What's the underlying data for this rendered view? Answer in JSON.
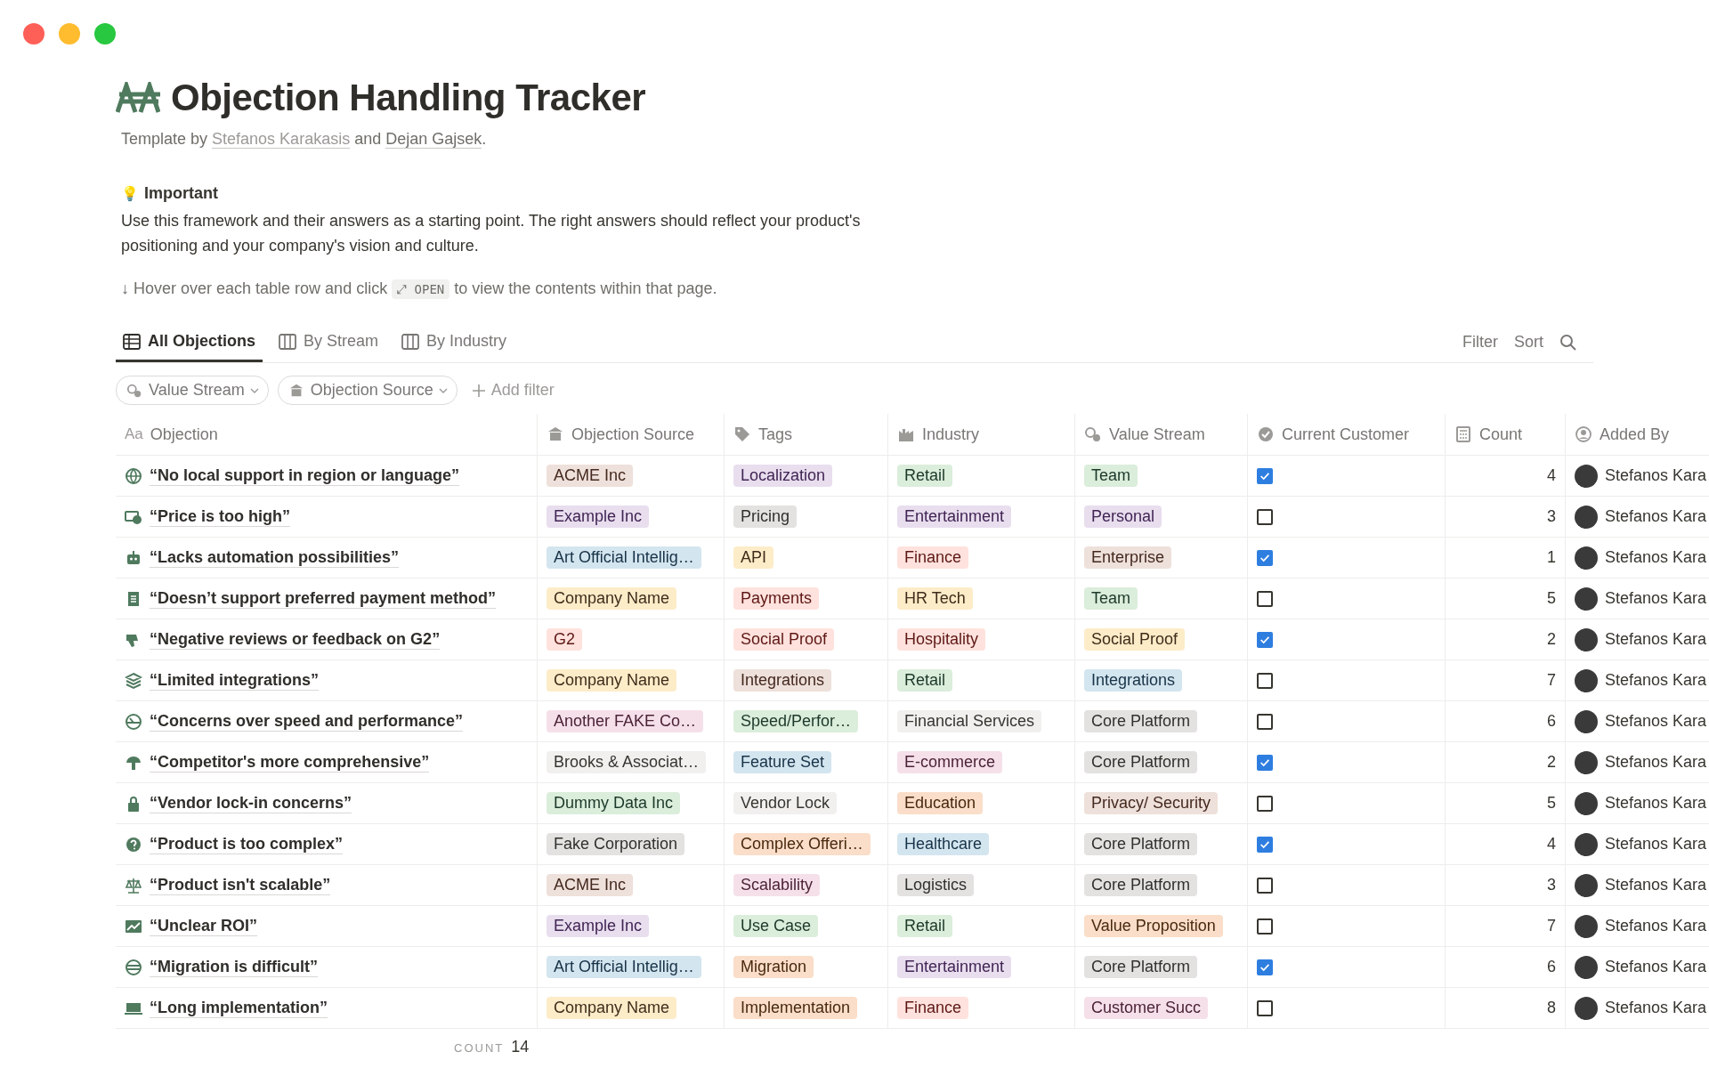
{
  "page": {
    "title": "Objection Handling Tracker",
    "byline": [
      {
        "kind": "text",
        "text": "Template by "
      },
      {
        "kind": "link",
        "text": "Stefanos Karakasis"
      },
      {
        "kind": "text",
        "text": " and "
      },
      {
        "kind": "link",
        "text": "Dejan Gajsek"
      },
      {
        "kind": "text",
        "text": "."
      }
    ],
    "callout": {
      "icon": "💡",
      "heading": "Important",
      "body": "Use this framework and their answers as a starting point. The right answers should reflect your product's positioning and your company's vision and culture."
    },
    "hint": {
      "before": "↓ Hover over each table row and click",
      "chip": "⤢ OPEN",
      "after": "to view the contents within that page."
    }
  },
  "tabs": [
    {
      "label": "All Objections",
      "selected": true,
      "kind": "table"
    },
    {
      "label": "By Stream",
      "selected": false,
      "kind": "board"
    },
    {
      "label": "By Industry",
      "selected": false,
      "kind": "board"
    }
  ],
  "toolbar": [
    "Filter",
    "Sort"
  ],
  "filters": [
    {
      "label": "Value Stream",
      "kind": "chip"
    },
    {
      "label": "Objection Source",
      "kind": "chip"
    },
    {
      "label": "Add filter",
      "kind": "add"
    }
  ],
  "table": {
    "columns": [
      {
        "label": "Objection",
        "prefix": "Aa",
        "kind": "title"
      },
      {
        "label": "Objection Source",
        "kind": "source"
      },
      {
        "label": "Tags",
        "kind": "tags"
      },
      {
        "label": "Industry",
        "kind": "industry"
      },
      {
        "label": "Value Stream",
        "kind": "stream"
      },
      {
        "label": "Current Customer",
        "kind": "customer"
      },
      {
        "label": "Count",
        "kind": "count"
      },
      {
        "label": "Added By",
        "kind": "person"
      }
    ],
    "rows": [
      {
        "objection": "“No local support in region or language”",
        "source": {
          "text": "ACME Inc",
          "color": "#eee0da"
        },
        "tag": {
          "text": "Localization",
          "color": "#e8deee"
        },
        "industry": {
          "text": "Retail",
          "color": "#dbeddb"
        },
        "stream": {
          "text": "Team",
          "color": "#dbeddb"
        },
        "current_customer": true,
        "count": "4",
        "added_by": "Stefanos Kara"
      },
      {
        "objection": "“Price is too high”",
        "source": {
          "text": "Example Inc",
          "color": "#e8deee"
        },
        "tag": {
          "text": "Pricing",
          "color": "#e3e2e0"
        },
        "industry": {
          "text": "Entertainment",
          "color": "#e8deee"
        },
        "stream": {
          "text": "Personal",
          "color": "#e8deee"
        },
        "current_customer": false,
        "count": "3",
        "added_by": "Stefanos Kara"
      },
      {
        "objection": "“Lacks automation possibilities”",
        "source": {
          "text": "Art Official Intellig…",
          "color": "#d3e5ef"
        },
        "tag": {
          "text": "API",
          "color": "#fdecc8"
        },
        "industry": {
          "text": "Finance",
          "color": "#ffe2dd"
        },
        "stream": {
          "text": "Enterprise",
          "color": "#eee0da"
        },
        "current_customer": true,
        "count": "1",
        "added_by": "Stefanos Kara"
      },
      {
        "objection": "“Doesn’t support preferred payment method”",
        "source": {
          "text": "Company Name",
          "color": "#fdecc8"
        },
        "tag": {
          "text": "Payments",
          "color": "#ffe2dd"
        },
        "industry": {
          "text": "HR Tech",
          "color": "#fdecc8"
        },
        "stream": {
          "text": "Team",
          "color": "#dbeddb"
        },
        "current_customer": false,
        "count": "5",
        "added_by": "Stefanos Kara"
      },
      {
        "objection": "“Negative reviews or feedback on G2”",
        "source": {
          "text": "G2",
          "color": "#ffe2dd"
        },
        "tag": {
          "text": "Social Proof",
          "color": "#ffe2dd"
        },
        "industry": {
          "text": "Hospitality",
          "color": "#ffe2dd"
        },
        "stream": {
          "text": "Social Proof",
          "color": "#fdecc8"
        },
        "current_customer": true,
        "count": "2",
        "added_by": "Stefanos Kara"
      },
      {
        "objection": "“Limited integrations”",
        "source": {
          "text": "Company Name",
          "color": "#fdecc8"
        },
        "tag": {
          "text": "Integrations",
          "color": "#eee0da"
        },
        "industry": {
          "text": "Retail",
          "color": "#dbeddb"
        },
        "stream": {
          "text": "Integrations",
          "color": "#d3e5ef"
        },
        "current_customer": false,
        "count": "7",
        "added_by": "Stefanos Kara"
      },
      {
        "objection": "“Concerns over speed and performance”",
        "source": {
          "text": "Another FAKE Co…",
          "color": "#f5e0e9"
        },
        "tag": {
          "text": "Speed/Perfor…",
          "color": "#dbeddb"
        },
        "industry": {
          "text": "Financial Services",
          "color": "#f1f0ef"
        },
        "stream": {
          "text": "Core Platform",
          "color": "#e3e2e0"
        },
        "current_customer": false,
        "count": "6",
        "added_by": "Stefanos Kara"
      },
      {
        "objection": "“Competitor's more comprehensive”",
        "source": {
          "text": "Brooks & Associat…",
          "color": "#f1f0ef"
        },
        "tag": {
          "text": "Feature Set",
          "color": "#d3e5ef"
        },
        "industry": {
          "text": "E-commerce",
          "color": "#f5e0e9"
        },
        "stream": {
          "text": "Core Platform",
          "color": "#e3e2e0"
        },
        "current_customer": true,
        "count": "2",
        "added_by": "Stefanos Kara"
      },
      {
        "objection": "“Vendor lock-in concerns”",
        "source": {
          "text": "Dummy Data Inc",
          "color": "#dbeddb"
        },
        "tag": {
          "text": "Vendor Lock",
          "color": "#f1f0ef"
        },
        "industry": {
          "text": "Education",
          "color": "#fadec9"
        },
        "stream": {
          "text": "Privacy/ Security",
          "color": "#eee0da"
        },
        "current_customer": false,
        "count": "5",
        "added_by": "Stefanos Kara"
      },
      {
        "objection": "“Product is too complex”",
        "source": {
          "text": "Fake Corporation",
          "color": "#e3e2e0"
        },
        "tag": {
          "text": "Complex Offeri…",
          "color": "#fadec9"
        },
        "industry": {
          "text": "Healthcare",
          "color": "#d3e5ef"
        },
        "stream": {
          "text": "Core Platform",
          "color": "#e3e2e0"
        },
        "current_customer": true,
        "count": "4",
        "added_by": "Stefanos Kara"
      },
      {
        "objection": "“Product isn't scalable”",
        "source": {
          "text": "ACME Inc",
          "color": "#eee0da"
        },
        "tag": {
          "text": "Scalability",
          "color": "#f5e0e9"
        },
        "industry": {
          "text": "Logistics",
          "color": "#e3e2e0"
        },
        "stream": {
          "text": "Core Platform",
          "color": "#e3e2e0"
        },
        "current_customer": false,
        "count": "3",
        "added_by": "Stefanos Kara"
      },
      {
        "objection": "“Unclear ROI”",
        "source": {
          "text": "Example Inc",
          "color": "#e8deee"
        },
        "tag": {
          "text": "Use Case",
          "color": "#dbeddb"
        },
        "industry": {
          "text": "Retail",
          "color": "#dbeddb"
        },
        "stream": {
          "text": "Value Proposition",
          "color": "#fadec9"
        },
        "current_customer": false,
        "count": "7",
        "added_by": "Stefanos Kara"
      },
      {
        "objection": "“Migration is difficult”",
        "source": {
          "text": "Art Official Intellig…",
          "color": "#d3e5ef"
        },
        "tag": {
          "text": "Migration",
          "color": "#fadec9"
        },
        "industry": {
          "text": "Entertainment",
          "color": "#e8deee"
        },
        "stream": {
          "text": "Core Platform",
          "color": "#e3e2e0"
        },
        "current_customer": true,
        "count": "6",
        "added_by": "Stefanos Kara"
      },
      {
        "objection": "“Long implementation”",
        "source": {
          "text": "Company Name",
          "color": "#fdecc8"
        },
        "tag": {
          "text": "Implementation",
          "color": "#fadec9"
        },
        "industry": {
          "text": "Finance",
          "color": "#ffe2dd"
        },
        "stream": {
          "text": "Customer Succ",
          "color": "#f5e0e9"
        },
        "current_customer": false,
        "count": "8",
        "added_by": "Stefanos Kara"
      }
    ],
    "footer": {
      "label": "COUNT",
      "value": "14"
    }
  }
}
